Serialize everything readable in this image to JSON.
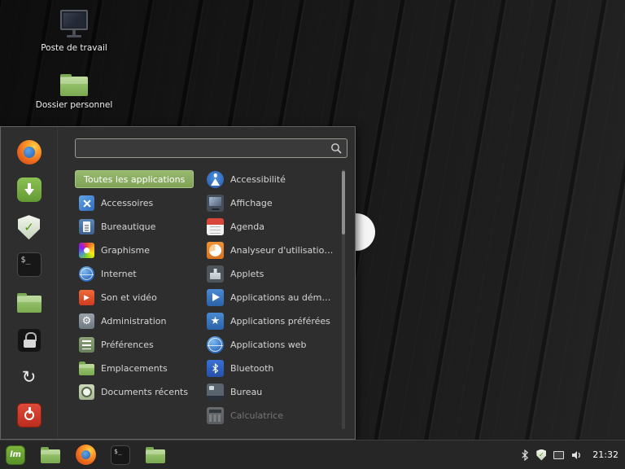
{
  "colors": {
    "accent_green": "#8bae62",
    "menu_background": "#2e2e2e",
    "taskbar_background": "#262626",
    "firefox_orange": "#ec6a1f",
    "mint_logo_green": "#69a32f",
    "folder_green": "#8fbf6f"
  },
  "glyphs": {
    "terminal_prompt": "$_"
  },
  "desktop": {
    "icons": [
      {
        "label": "Poste de travail",
        "icon": "computer-icon"
      },
      {
        "label": "Dossier personnel",
        "icon": "home-folder-icon"
      }
    ]
  },
  "menu": {
    "search": {
      "value": "",
      "icon": "search-icon"
    },
    "favorites": [
      {
        "icon": "firefox-icon"
      },
      {
        "icon": "software-manager-icon"
      },
      {
        "icon": "update-manager-icon"
      },
      {
        "icon": "terminal-icon"
      },
      {
        "icon": "files-icon"
      },
      {
        "icon": "lock-screen-icon"
      },
      {
        "icon": "logout-icon"
      },
      {
        "icon": "quit-icon"
      }
    ],
    "categories": [
      {
        "label": "Toutes les applications",
        "active": true
      },
      {
        "label": "Accessoires",
        "icon": "accessories-icon"
      },
      {
        "label": "Bureautique",
        "icon": "office-icon"
      },
      {
        "label": "Graphisme",
        "icon": "graphics-icon"
      },
      {
        "label": "Internet",
        "icon": "internet-icon"
      },
      {
        "label": "Son et vidéo",
        "icon": "sound-video-icon"
      },
      {
        "label": "Administration",
        "icon": "administration-icon"
      },
      {
        "label": "Préférences",
        "icon": "preferences-icon"
      },
      {
        "label": "Emplacements",
        "icon": "places-icon"
      },
      {
        "label": "Documents récents",
        "icon": "recent-documents-icon"
      }
    ],
    "apps": [
      {
        "label": "Accessibilité",
        "icon": "accessibility-icon"
      },
      {
        "label": "Affichage",
        "icon": "display-icon"
      },
      {
        "label": "Agenda",
        "icon": "calendar-icon"
      },
      {
        "label": "Analyseur d'utilisation des…",
        "icon": "disk-usage-icon"
      },
      {
        "label": "Applets",
        "icon": "applets-icon"
      },
      {
        "label": "Applications au démarrage",
        "icon": "startup-apps-icon"
      },
      {
        "label": "Applications préférées",
        "icon": "favorite-apps-icon"
      },
      {
        "label": "Applications web",
        "icon": "web-apps-icon"
      },
      {
        "label": "Bluetooth",
        "icon": "bluetooth-icon"
      },
      {
        "label": "Bureau",
        "icon": "desktop-settings-icon"
      },
      {
        "label": "Calculatrice",
        "icon": "calculator-icon",
        "faded": true
      }
    ]
  },
  "taskbar": {
    "menu_button": {
      "icon": "mint-menu-icon",
      "logo_text": "lm"
    },
    "launchers": [
      {
        "icon": "files-icon"
      },
      {
        "icon": "firefox-icon"
      },
      {
        "icon": "terminal-icon"
      },
      {
        "icon": "folder-icon"
      }
    ],
    "tray": [
      {
        "icon": "bluetooth-icon"
      },
      {
        "icon": "update-shield-icon"
      },
      {
        "icon": "network-icon"
      },
      {
        "icon": "volume-icon"
      }
    ],
    "clock": "21:32"
  }
}
